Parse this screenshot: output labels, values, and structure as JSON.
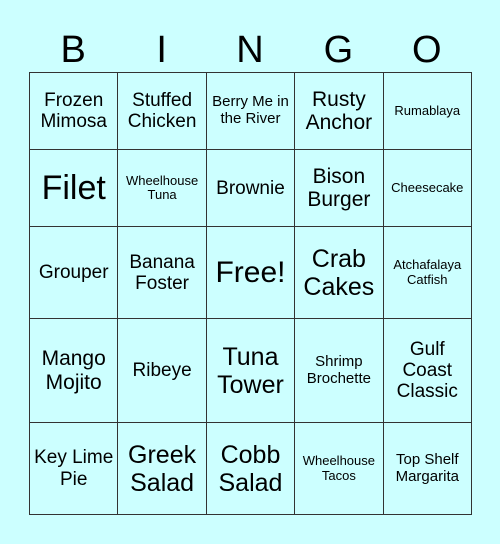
{
  "header": {
    "letters": [
      "B",
      "I",
      "N",
      "G",
      "O"
    ]
  },
  "grid": [
    [
      "Frozen Mimosa",
      "Stuffed Chicken",
      "Berry Me in the River",
      "Rusty Anchor",
      "Rumablaya"
    ],
    [
      "Filet",
      "Wheelhouse Tuna",
      "Brownie",
      "Bison Burger",
      "Cheesecake"
    ],
    [
      "Grouper",
      "Banana Foster",
      "Free!",
      "Crab Cakes",
      "Atchafalaya Catfish"
    ],
    [
      "Mango Mojito",
      "Ribeye",
      "Tuna Tower",
      "Shrimp Brochette",
      "Gulf Coast Classic"
    ],
    [
      "Key Lime Pie",
      "Greek Salad",
      "Cobb Salad",
      "Wheelhouse Tacos",
      "Top Shelf Margarita"
    ]
  ],
  "colors": {
    "background": "#ccffff",
    "border": "#333333",
    "text": "#000000"
  }
}
